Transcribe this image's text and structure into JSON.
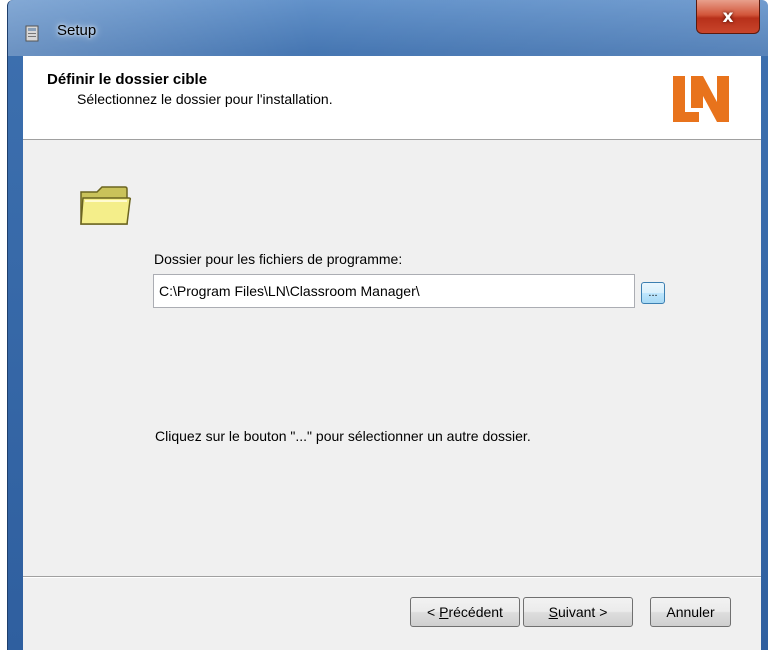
{
  "window": {
    "title": "Setup",
    "close_symbol": "x"
  },
  "header": {
    "title": "Définir le dossier cible",
    "subtitle": "Sélectionnez le dossier pour l'installation.",
    "logo_text": "LN",
    "logo_color": "#e8731c"
  },
  "main": {
    "folder_icon": "folder-icon",
    "field_label": "Dossier pour les fichiers de programme:",
    "path_value": "C:\\Program Files\\LN\\Classroom Manager\\",
    "browse_label": "...",
    "hint": "Cliquez sur le bouton \"...\" pour sélectionner un autre dossier."
  },
  "footer": {
    "prev_prefix": "< ",
    "prev_mnemonic": "P",
    "prev_rest": "récédent",
    "next_mnemonic": "S",
    "next_rest": "uivant >",
    "cancel_label": "Annuler"
  }
}
